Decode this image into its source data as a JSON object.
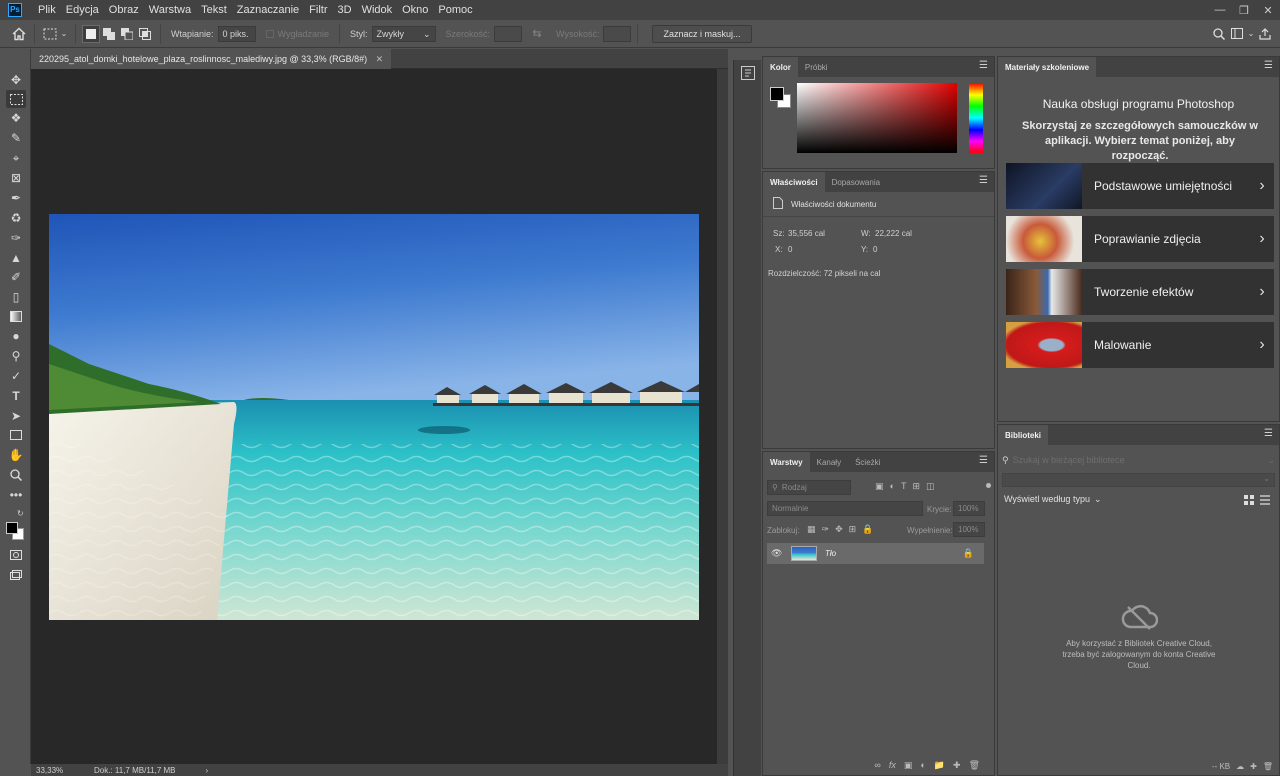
{
  "menu": {
    "logo": "Ps",
    "items": [
      "Plik",
      "Edycja",
      "Obraz",
      "Warstwa",
      "Tekst",
      "Zaznaczanie",
      "Filtr",
      "3D",
      "Widok",
      "Okno",
      "Pomoc"
    ]
  },
  "options": {
    "feather_label": "Wtapianie:",
    "feather_value": "0 piks.",
    "antialias_label": "Wygładzanie",
    "style_label": "Styl:",
    "style_value": "Zwykły",
    "width_label": "Szerokość:",
    "height_label": "Wysokość:",
    "select_mask_label": "Zaznacz i maskuj..."
  },
  "document": {
    "tab_title": "220295_atol_domki_hotelowe_plaza_roslinnosc_malediwy.jpg @ 33,3% (RGB/8#)",
    "zoom": "33,33%",
    "doc_size": "Dok.: 11,7 MB/11,7 MB"
  },
  "color_panel": {
    "tabs": [
      "Kolor",
      "Próbki"
    ],
    "foreground": "#000000",
    "background": "#ffffff",
    "hue_color": "#e00000"
  },
  "properties_panel": {
    "tabs": [
      "Właściwości",
      "Dopasowania"
    ],
    "section_title": "Właściwości dokumentu",
    "width_label": "Sz:",
    "width_value": "35,556 cal",
    "height_label": "W:",
    "height_value": "22,222 cal",
    "x_label": "X:",
    "x_value": "0",
    "y_label": "Y:",
    "y_value": "0",
    "resolution": "Rozdzielczość: 72 pikseli na cal"
  },
  "layers_panel": {
    "tabs": [
      "Warstwy",
      "Kanały",
      "Ścieżki"
    ],
    "filter_placeholder": "Rodzaj",
    "blend_mode": "Normalnie",
    "opacity_label": "Krycie:",
    "opacity_value": "100%",
    "lock_label": "Zablokuj:",
    "fill_label": "Wypełnienie:",
    "fill_value": "100%",
    "layers": [
      {
        "name": "Tło",
        "visible": true,
        "locked": true
      }
    ]
  },
  "learn_panel": {
    "tab": "Materiały szkoleniowe",
    "heading": "Nauka obsługi programu Photoshop",
    "subheading": "Skorzystaj ze szczegółowych samouczków w aplikacji. Wybierz temat poniżej, aby rozpocząć.",
    "cards": [
      {
        "label": "Podstawowe umiejętności",
        "thumb": "#1c2a46"
      },
      {
        "label": "Poprawianie zdjęcia",
        "thumb": "#c88a54"
      },
      {
        "label": "Tworzenie efektów",
        "thumb": "#6e4a36"
      },
      {
        "label": "Malowanie",
        "thumb": "#d41c1c"
      }
    ]
  },
  "libraries_panel": {
    "tab": "Biblioteki",
    "search_placeholder": "Szukaj w bieżącej bibliotece",
    "view_by": "Wyświetl według typu",
    "message": "Aby korzystać z Bibliotek Creative Cloud, trzeba być zalogowanym do konta Creative Cloud.",
    "size": "-- KB"
  }
}
